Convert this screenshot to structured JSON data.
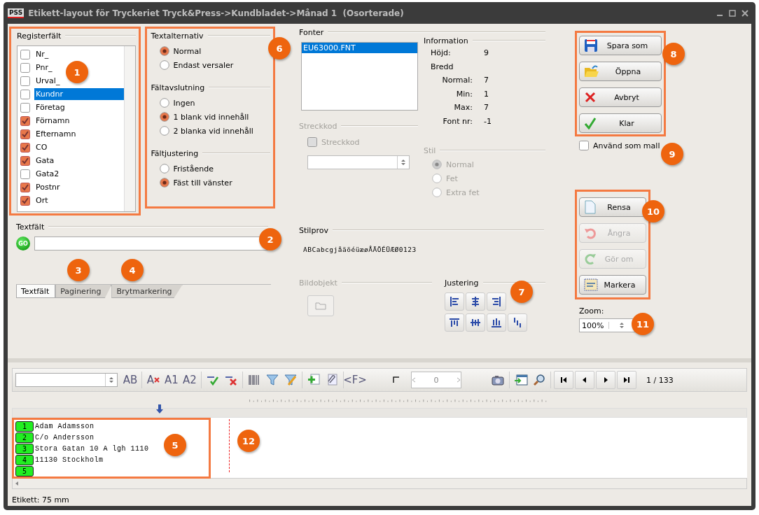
{
  "window": {
    "logo": "PSS",
    "title": "Etikett-layout för Tryckeriet Tryck&Press->Kundbladet->Månad 1  (Osorterade)"
  },
  "register": {
    "title": "Registerfält",
    "outlined": true,
    "items": [
      {
        "label": "Nr_",
        "checked": false,
        "selected": false
      },
      {
        "label": "Pnr_",
        "checked": false,
        "selected": false
      },
      {
        "label": "Urval_",
        "checked": false,
        "selected": false
      },
      {
        "label": "Kundnr",
        "checked": false,
        "selected": true
      },
      {
        "label": "Företag",
        "checked": false,
        "selected": false
      },
      {
        "label": "Förnamn",
        "checked": true,
        "selected": false
      },
      {
        "label": "Efternamn",
        "checked": true,
        "selected": false
      },
      {
        "label": "CO",
        "checked": true,
        "selected": false
      },
      {
        "label": "Gata",
        "checked": true,
        "selected": false
      },
      {
        "label": "Gata2",
        "checked": false,
        "selected": false
      },
      {
        "label": "Postnr",
        "checked": true,
        "selected": false
      },
      {
        "label": "Ort",
        "checked": true,
        "selected": false
      }
    ]
  },
  "text_options": {
    "outlined": true,
    "groups": [
      {
        "title": "Textalternativ",
        "options": [
          {
            "label": "Normal",
            "selected": true
          },
          {
            "label": "Endast versaler",
            "selected": false
          }
        ]
      },
      {
        "title": "Fältavslutning",
        "options": [
          {
            "label": "Ingen",
            "selected": false
          },
          {
            "label": "1 blank vid innehåll",
            "selected": true
          },
          {
            "label": "2 blanka vid innehåll",
            "selected": false
          }
        ]
      },
      {
        "title": "Fältjustering",
        "options": [
          {
            "label": "Fristående",
            "selected": false
          },
          {
            "label": "Fäst till vänster",
            "selected": true
          }
        ]
      }
    ]
  },
  "textfield": {
    "title": "Textfält",
    "go_label": "GO"
  },
  "tabs": [
    {
      "label": "Textfält",
      "selected": true
    },
    {
      "label": "Paginering",
      "selected": false
    },
    {
      "label": "Brytmarkering",
      "selected": false
    }
  ],
  "fonts": {
    "title": "Fonter",
    "items": [
      {
        "label": "EU63000.FNT",
        "selected": true
      }
    ]
  },
  "information": {
    "title": "Information",
    "rows": [
      {
        "kind": "heading",
        "label": "Höjd:",
        "value": "9"
      },
      {
        "kind": "heading",
        "label": "Bredd"
      },
      {
        "kind": "sub",
        "label": "Normal:",
        "value": "7"
      },
      {
        "kind": "sub",
        "label": "Min:",
        "value": "1"
      },
      {
        "kind": "sub",
        "label": "Max:",
        "value": "7"
      },
      {
        "kind": "sub",
        "label": "Font nr:",
        "value": "-1"
      }
    ]
  },
  "barcode": {
    "title": "Streckkod",
    "disabled": true,
    "checkbox": {
      "label": "Streckkod",
      "checked": false
    }
  },
  "style": {
    "title": "Stil",
    "disabled": true,
    "options": [
      {
        "label": "Normal",
        "selected": true
      },
      {
        "label": "Fet",
        "selected": false
      },
      {
        "label": "Extra fet",
        "selected": false
      }
    ]
  },
  "sample": {
    "title": "Stilprov",
    "text": "ABCabcgjåäöéüæøÅÄÖÉÜÆØ0123"
  },
  "image_object": {
    "title": "Bildobjekt",
    "disabled": true
  },
  "alignment": {
    "title": "Justering",
    "buttons": [
      {
        "kind": "left"
      },
      {
        "kind": "center"
      },
      {
        "kind": "right"
      },
      {
        "kind": "top"
      },
      {
        "kind": "middle"
      },
      {
        "kind": "bottom"
      },
      {
        "kind": "stagger"
      }
    ]
  },
  "actions": {
    "outlined": true,
    "buttons": [
      {
        "label": "Spara som",
        "kind": "save",
        "disabled": false
      },
      {
        "label": "Öppna",
        "kind": "open",
        "disabled": false
      },
      {
        "label": "Avbryt",
        "kind": "cancel",
        "disabled": false
      },
      {
        "label": "Klar",
        "kind": "ok",
        "disabled": false
      }
    ]
  },
  "template": {
    "label": "Använd som mall",
    "checked": false
  },
  "edit_actions": {
    "outlined": true,
    "buttons": [
      {
        "label": "Rensa",
        "kind": "new",
        "disabled": false
      },
      {
        "label": "Ångra",
        "kind": "undo",
        "disabled": true
      },
      {
        "label": "Gör om",
        "kind": "redo",
        "disabled": true
      },
      {
        "label": "Markera",
        "kind": "mark",
        "disabled": false
      }
    ]
  },
  "zoom": {
    "label": "Zoom:",
    "value": "100%"
  },
  "toolbar": {
    "buttons": [
      {
        "kind": "text",
        "label": "AB"
      },
      {
        "kind": "separator"
      },
      {
        "kind": "text-clear",
        "label": "A"
      },
      {
        "kind": "text",
        "label": "A1"
      },
      {
        "kind": "text",
        "label": "A2"
      },
      {
        "kind": "separator"
      },
      {
        "kind": "accept"
      },
      {
        "kind": "reject"
      },
      {
        "kind": "separator"
      },
      {
        "kind": "barcode"
      },
      {
        "kind": "filter"
      },
      {
        "kind": "filter-edit"
      },
      {
        "kind": "separator"
      },
      {
        "kind": "add"
      },
      {
        "kind": "attach"
      },
      {
        "kind": "separator"
      },
      {
        "kind": "text",
        "label": "<F>"
      }
    ],
    "counter": "0",
    "tools": [
      {
        "kind": "camera"
      },
      {
        "kind": "separator"
      },
      {
        "kind": "export"
      },
      {
        "kind": "search"
      }
    ],
    "nav": [
      {
        "kind": "first"
      },
      {
        "kind": "prev"
      },
      {
        "kind": "next"
      },
      {
        "kind": "last"
      }
    ],
    "page": "1 / 133"
  },
  "editor": {
    "outlined": true,
    "lines": [
      {
        "number": "1",
        "text": "Adam Adamsson"
      },
      {
        "number": "2",
        "text": "C/o Andersson"
      },
      {
        "number": "3",
        "text": "Stora Gatan 10 A lgh 1110"
      },
      {
        "number": "4",
        "text": "11130 Stockholm"
      },
      {
        "number": "5"
      }
    ]
  },
  "status": "Etikett: 75 mm",
  "callouts": [
    {
      "label": "1"
    },
    {
      "label": "2"
    },
    {
      "label": "3"
    },
    {
      "label": "4"
    },
    {
      "label": "5"
    },
    {
      "label": "6"
    },
    {
      "label": "7"
    },
    {
      "label": "8"
    },
    {
      "label": "9"
    },
    {
      "label": "10"
    },
    {
      "label": "11"
    },
    {
      "label": "12"
    }
  ]
}
